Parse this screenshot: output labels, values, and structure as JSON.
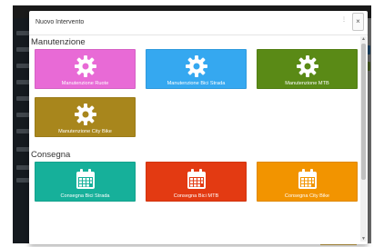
{
  "modal": {
    "title": "Nuovo Intervento",
    "close_label": "×"
  },
  "sections": [
    {
      "title": "Manutenzione",
      "tiles": [
        {
          "label": "Manutenzione Ruote",
          "color": "#e86ad6",
          "icon": "gear-icon"
        },
        {
          "label": "Manutenzione Bici Strada",
          "color": "#35a8f0",
          "icon": "gear-icon"
        },
        {
          "label": "Manutenzione MTB",
          "color": "#5a8a16",
          "icon": "gear-icon"
        },
        {
          "label": "Manutenzione City Bike",
          "color": "#a8861c",
          "icon": "gear-icon"
        }
      ]
    },
    {
      "title": "Consegna",
      "tiles": [
        {
          "label": "Consegna Bici Strada",
          "color": "#16b09a",
          "icon": "calendar-icon"
        },
        {
          "label": "Consegna Bici MTB",
          "color": "#e33a12",
          "icon": "calendar-icon"
        },
        {
          "label": "Consegna City Bike",
          "color": "#f29400",
          "icon": "calendar-icon"
        }
      ]
    }
  ]
}
